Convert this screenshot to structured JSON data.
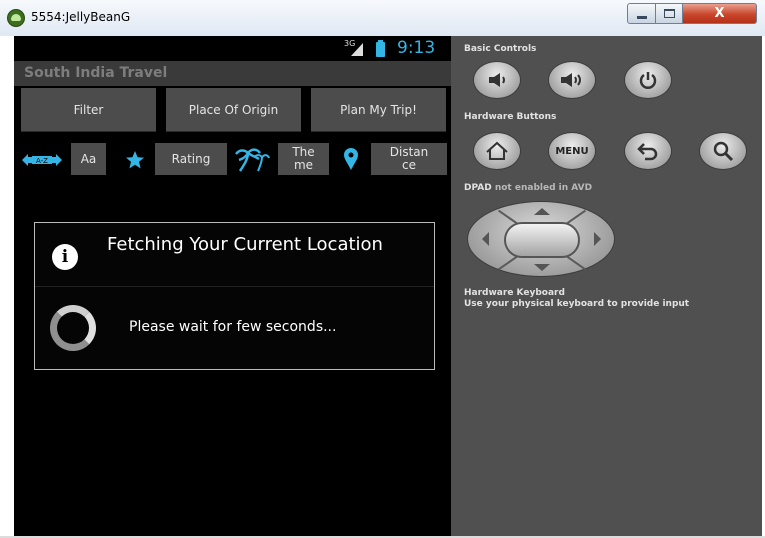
{
  "window": {
    "title": "5554:JellyBeanG",
    "close_glyph": "X"
  },
  "device": {
    "status_network": "3G",
    "status_time": "9:13",
    "app_title": "South India Travel",
    "tabs": [
      {
        "label": "Filter"
      },
      {
        "label": "Place Of Origin"
      },
      {
        "label": "Plan My Trip!"
      }
    ],
    "sort": {
      "az_icon": "a-z-sort-icon",
      "aa_label": "Aa",
      "rating_label": "Rating",
      "theme_label": "The\nme",
      "distance_label": "Distan\nce"
    },
    "dialog": {
      "title": "Fetching Your Current Location",
      "info_glyph": "i",
      "message": "Please wait for few seconds..."
    }
  },
  "panel": {
    "basic_controls": "Basic Controls",
    "hardware_buttons": "Hardware Buttons",
    "menu_label": "MENU",
    "dpad_label": "DPAD",
    "dpad_note": "not enabled in AVD",
    "keyboard_title": "Hardware Keyboard",
    "keyboard_note": "Use your physical keyboard to provide input"
  },
  "colors": {
    "accent": "#33b5e5",
    "panel_bg": "#505050",
    "button_bg": "#4c4c4c"
  }
}
